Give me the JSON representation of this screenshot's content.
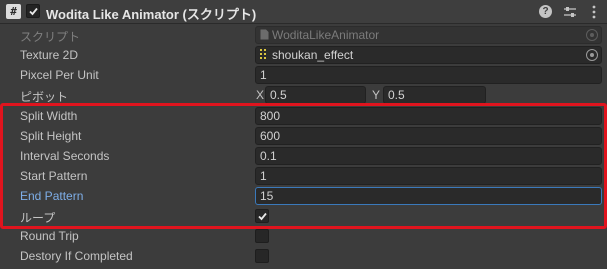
{
  "header": {
    "title": "Wodita Like Animator (スクリプト)",
    "script_icon_glyph": "#",
    "enabled": true,
    "icons": [
      "help-icon",
      "presets-icon",
      "more-options-icon"
    ]
  },
  "fields": {
    "script": {
      "label": "スクリプト",
      "value": "WoditaLikeAnimator"
    },
    "texture": {
      "label": "Texture 2D",
      "value": "shoukan_effect"
    },
    "pixels_per_unit": {
      "label": "Pixcel Per Unit",
      "value": "1"
    },
    "pivot": {
      "label": "ピボット",
      "x_label": "X",
      "x_value": "0.5",
      "y_label": "Y",
      "y_value": "0.5"
    },
    "split_width": {
      "label": "Split Width",
      "value": "800"
    },
    "split_height": {
      "label": "Split Height",
      "value": "600"
    },
    "interval_seconds": {
      "label": "Interval Seconds",
      "value": "0.1"
    },
    "start_pattern": {
      "label": "Start Pattern",
      "value": "1"
    },
    "end_pattern": {
      "label": "End Pattern",
      "value": "15"
    },
    "loop": {
      "label": "ループ",
      "checked": true
    },
    "round_trip": {
      "label": "Round Trip",
      "checked": false
    },
    "destroy_if_completed": {
      "label": "Destory If Completed",
      "checked": false
    }
  },
  "colors": {
    "background": "#3c3c3c",
    "focus_label": "#7eaee8",
    "focus_border": "#3a79bb",
    "highlight": "#e0141e"
  }
}
